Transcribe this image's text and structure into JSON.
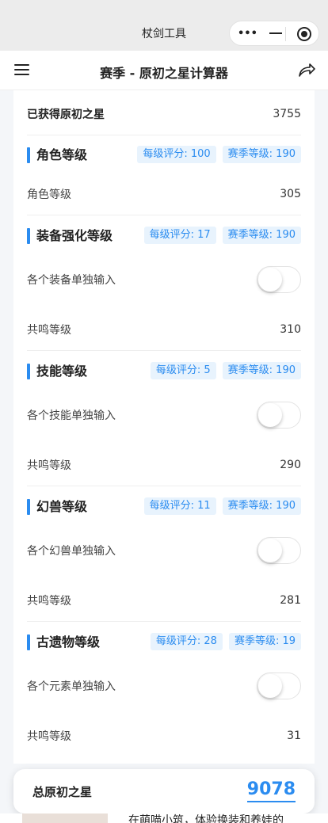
{
  "app": {
    "title": "杖剑工具"
  },
  "navbar": {
    "title": "赛季 - 原初之星计算器"
  },
  "obtained": {
    "label": "已获得原初之星",
    "value": "3755"
  },
  "sections": [
    {
      "title": "角色等级",
      "tag1": "每级评分: 100",
      "tag2": "赛季等级: 190",
      "level_label": "角色等级",
      "level_value": "305"
    },
    {
      "title": "装备强化等级",
      "tag1": "每级评分: 17",
      "tag2": "赛季等级: 190",
      "toggle_label": "各个装备单独输入",
      "level_label": "共鸣等级",
      "level_value": "310"
    },
    {
      "title": "技能等级",
      "tag1": "每级评分: 5",
      "tag2": "赛季等级: 190",
      "toggle_label": "各个技能单独输入",
      "level_label": "共鸣等级",
      "level_value": "290"
    },
    {
      "title": "幻兽等级",
      "tag1": "每级评分: 11",
      "tag2": "赛季等级: 190",
      "toggle_label": "各个幻兽单独输入",
      "level_label": "共鸣等级",
      "level_value": "281"
    },
    {
      "title": "古遗物等级",
      "tag1": "每级评分: 28",
      "tag2": "赛季等级: 19",
      "toggle_label": "各个元素单独输入",
      "level_label": "共鸣等级",
      "level_value": "31"
    }
  ],
  "total": {
    "label": "总原初之星",
    "value": "9078"
  },
  "peek": {
    "text": "在萌喵小筑，体验换装和养娃的"
  },
  "colors": {
    "accent": "#2b8cf0",
    "tag_bg": "#e8f3fd"
  }
}
